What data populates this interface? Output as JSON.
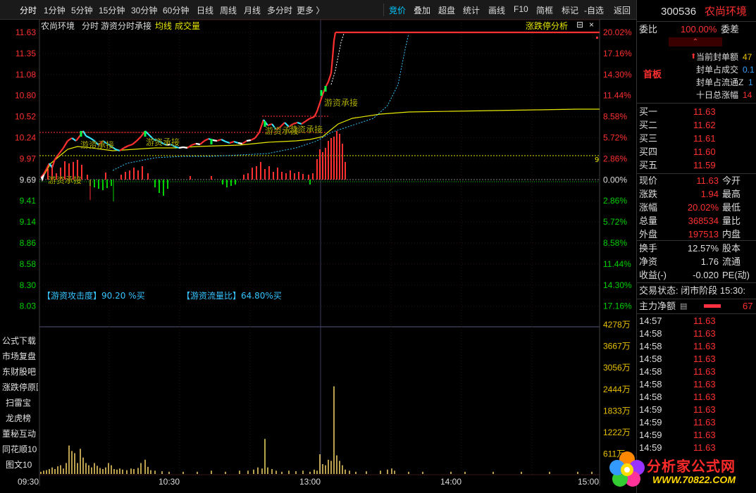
{
  "toolbar": {
    "periods": [
      "分时",
      "1分钟",
      "5分钟",
      "15分钟",
      "30分钟",
      "60分钟",
      "日线",
      "周线",
      "月线",
      "多分时",
      "更多 〉"
    ],
    "tools": [
      "竞价",
      "叠加",
      "超盘",
      "统计",
      "画线",
      "F10",
      "简框",
      "标记",
      "-自选",
      "返回"
    ]
  },
  "chart_header": {
    "stock_name": "农尚环境",
    "mode": "分时",
    "indicator": "游资分时承接",
    "avg_line": "均线",
    "volume": "成交量",
    "limit_analysis": "涨跌停分析"
  },
  "colors": {
    "up": "#ff3030",
    "down": "#00d000",
    "avg": "#e8e800",
    "label": "#ffff00",
    "cyan": "#35c5ff"
  },
  "price_axis": {
    "prices": [
      "11.63",
      "11.35",
      "11.08",
      "10.80",
      "10.52",
      "10.24",
      "9.97",
      "9.69",
      "9.41",
      "9.14",
      "8.86",
      "8.58",
      "8.30",
      "8.03"
    ],
    "percents": [
      "20.02%",
      "17.16%",
      "14.30%",
      "11.44%",
      "8.58%",
      "5.72%",
      "2.86%",
      "0.00%",
      "2.86%",
      "5.72%",
      "8.58%",
      "11.44%",
      "14.30%",
      "17.16%"
    ],
    "volumes": [
      "4278万",
      "3667万",
      "3056万",
      "2444万",
      "1833万",
      "1222万",
      "611万"
    ]
  },
  "time_axis": [
    "09:30",
    "10:30",
    "13:00",
    "14:00",
    "15:00"
  ],
  "chart_labels": {
    "accept": "游资承接",
    "attack": "【游资攻击度】90.20 %买",
    "flow": "【游资流量比】64.80%买"
  },
  "left_buttons": [
    "公式下载",
    "市场复盘",
    "东财股吧",
    "涨跌停原因",
    "扫雷宝",
    "龙虎榜",
    "董秘互动",
    "同花顺10",
    "图文10"
  ],
  "quote": {
    "code": "300536",
    "name": "农尚环境",
    "weibi_label": "委比",
    "weibi": "100.00%",
    "weicha_label": "委差",
    "first_board": "首板",
    "seal_info": [
      {
        "label": "当前封单额",
        "value": "47"
      },
      {
        "label": "封单占成交",
        "value": "0.1"
      },
      {
        "label": "封单占流通Z",
        "value": "1"
      },
      {
        "label": "十日总涨幅",
        "value": "14"
      }
    ],
    "bids": [
      {
        "label": "买一",
        "price": "11.63"
      },
      {
        "label": "买二",
        "price": "11.62"
      },
      {
        "label": "买三",
        "price": "11.61"
      },
      {
        "label": "买四",
        "price": "11.60"
      },
      {
        "label": "买五",
        "price": "11.59"
      }
    ],
    "stats": [
      {
        "l1": "现价",
        "v1": "11.63",
        "l2": "今开"
      },
      {
        "l1": "涨跌",
        "v1": "1.94",
        "l2": "最高"
      },
      {
        "l1": "涨幅",
        "v1": "20.02%",
        "l2": "最低"
      },
      {
        "l1": "总量",
        "v1": "368534",
        "l2": "量比"
      },
      {
        "l1": "外盘",
        "v1": "197513",
        "l2": "内盘"
      }
    ],
    "stats2": [
      {
        "l1": "换手",
        "v1": "12.57%",
        "l2": "股本"
      },
      {
        "l1": "净资",
        "v1": "1.76",
        "l2": "流通"
      },
      {
        "l1": "收益(-)",
        "v1": "-0.020",
        "l2": "PE(动)"
      }
    ],
    "trade_status": "交易状态: 闭市阶段 15:30:",
    "main_net_label": "主力净额",
    "main_net_value": "67",
    "ticks": [
      {
        "time": "14:57",
        "price": "11.63"
      },
      {
        "time": "14:58",
        "price": "11.63"
      },
      {
        "time": "14:58",
        "price": "11.63"
      },
      {
        "time": "14:58",
        "price": "11.63"
      },
      {
        "time": "14:58",
        "price": "11.63"
      },
      {
        "time": "14:58",
        "price": "11.63"
      },
      {
        "time": "14:58",
        "price": "11.63"
      },
      {
        "time": "14:59",
        "price": "11.63"
      },
      {
        "time": "14:59",
        "price": "11.63"
      },
      {
        "time": "14:59",
        "price": "11.63"
      },
      {
        "time": "14:59",
        "price": "11.63"
      }
    ]
  },
  "watermark": {
    "title": "分析家公式网",
    "url": "WWW.70822.COM"
  }
}
